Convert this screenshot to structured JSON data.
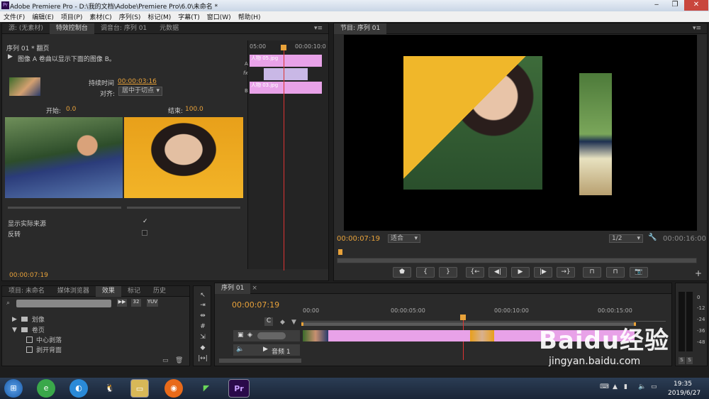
{
  "window": {
    "title": "Adobe Premiere Pro - D:\\我的文档\\Adobe\\Premiere Pro\\6.0\\未命名 *"
  },
  "menu": [
    "文件(F)",
    "编辑(E)",
    "项目(P)",
    "素材(C)",
    "序列(S)",
    "标记(M)",
    "字幕(T)",
    "窗口(W)",
    "帮助(H)"
  ],
  "source_tabs": [
    "源: (无素材)",
    "特效控制台",
    "调音台: 序列 01",
    "元数据"
  ],
  "effect_controls": {
    "header": "序列 01 * 翻页",
    "description": "图像 A 卷曲以显示下面的图像 B。",
    "duration_label": "持续时间",
    "duration_value": "00:00:03:16",
    "align_label": "对齐:",
    "align_value": "居中于切点",
    "start_label": "开始:",
    "start_value": "0.0",
    "end_label": "结束:",
    "end_value": "100.0",
    "show_source_label": "显示实际来源",
    "reverse_label": "反转",
    "time": "00:00:07:19",
    "mini_timeline": {
      "t0": "05:00",
      "t1": "00:00:10:0",
      "track_a": "A",
      "track_b": "B",
      "clip_a": "人物 05.jpg",
      "clip_b": "人物 03.jpg"
    }
  },
  "program": {
    "tab": "节目: 序列 01",
    "timecode": "00:00:07:19",
    "fit": "适合",
    "quality": "1/2",
    "duration": "00:00:16:00"
  },
  "project_tabs": [
    "项目: 未命名",
    "媒体浏览器",
    "效果",
    "标记",
    "历史"
  ],
  "effects_tree": [
    {
      "label": "划像",
      "level": 0,
      "expanded": false
    },
    {
      "label": "卷页",
      "level": 0,
      "expanded": true
    },
    {
      "label": "中心剥落",
      "level": 1
    },
    {
      "label": "剥开背面",
      "level": 1
    }
  ],
  "timeline": {
    "tab": "序列 01",
    "timecode": "00:00:07:19",
    "ruler": [
      "00:00",
      "00:00:05:00",
      "00:00:10:00",
      "00:00:15:00"
    ],
    "audio_track": "音频 1"
  },
  "meter": {
    "labels": [
      "0",
      "-12",
      "-24",
      "-36",
      "-48"
    ],
    "solo": [
      "S",
      "S"
    ]
  },
  "watermark": {
    "logo": "Baidu经验",
    "url": "jingyan.baidu.com"
  },
  "taskbar": {
    "time": "19:35",
    "date": "2019/6/27"
  },
  "colors": {
    "accent": "#e8a23a",
    "clip": "#e8a2e8",
    "playhead": "#d33"
  }
}
